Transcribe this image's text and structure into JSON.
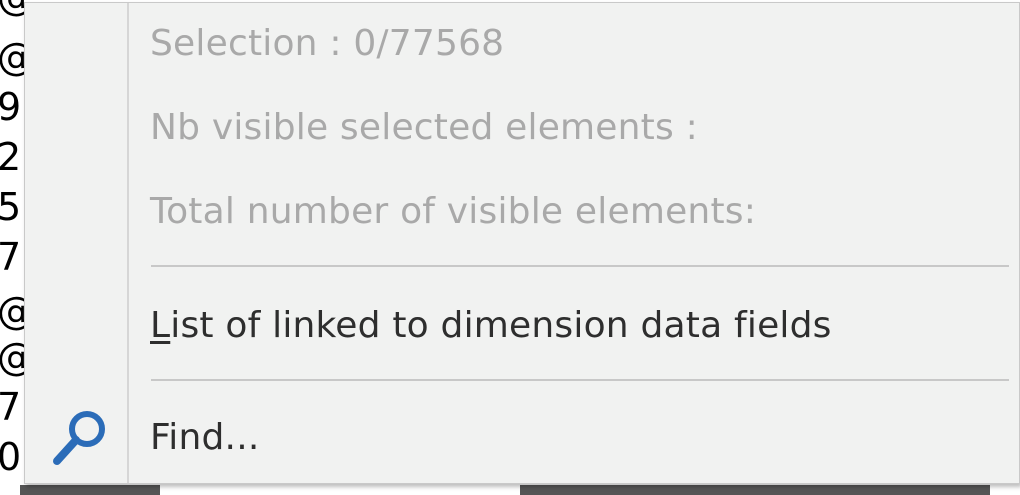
{
  "background": {
    "left_column_chars": [
      "@",
      "@",
      "9",
      "2",
      "5",
      "7",
      "@",
      "@",
      "7",
      "0"
    ]
  },
  "menu": {
    "items": [
      {
        "label": "Selection : 0/77568",
        "enabled": false
      },
      {
        "label": "Nb visible selected elements :",
        "enabled": false
      },
      {
        "label": "Total number of visible elements:",
        "enabled": false
      },
      {
        "label_mnemonic": "L",
        "label_rest": "ist of linked to dimension data fields",
        "enabled": true
      },
      {
        "label": "Find...",
        "enabled": true,
        "icon": "magnifier-icon"
      }
    ]
  },
  "colors": {
    "menu_bg": "#f1f2f1",
    "disabled_text": "#a9a9a9",
    "enabled_text": "#2e2e2e",
    "icon_blue": "#2b6cb8"
  }
}
